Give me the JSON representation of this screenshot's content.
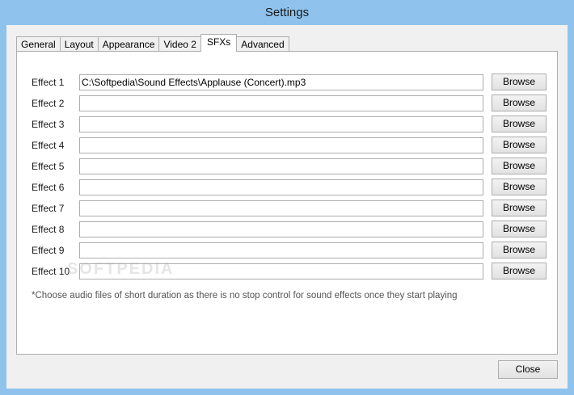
{
  "window": {
    "title": "Settings"
  },
  "tabs": [
    {
      "label": "General",
      "active": false
    },
    {
      "label": "Layout",
      "active": false
    },
    {
      "label": "Appearance",
      "active": false
    },
    {
      "label": "Video 2",
      "active": false
    },
    {
      "label": "SFXs",
      "active": true
    },
    {
      "label": "Advanced",
      "active": false
    }
  ],
  "effects": [
    {
      "label": "Effect 1",
      "value": "C:\\Softpedia\\Sound Effects\\Applause (Concert).mp3",
      "browse": "Browse"
    },
    {
      "label": "Effect 2",
      "value": "",
      "browse": "Browse"
    },
    {
      "label": "Effect 3",
      "value": "",
      "browse": "Browse"
    },
    {
      "label": "Effect 4",
      "value": "",
      "browse": "Browse"
    },
    {
      "label": "Effect 5",
      "value": "",
      "browse": "Browse"
    },
    {
      "label": "Effect 6",
      "value": "",
      "browse": "Browse"
    },
    {
      "label": "Effect 7",
      "value": "",
      "browse": "Browse"
    },
    {
      "label": "Effect 8",
      "value": "",
      "browse": "Browse"
    },
    {
      "label": "Effect 9",
      "value": "",
      "browse": "Browse"
    },
    {
      "label": "Effect 10",
      "value": "",
      "browse": "Browse"
    }
  ],
  "note": "*Choose audio files of short duration as there is no stop control for sound effects once they start playing",
  "watermark": "SOFTPEDIA",
  "footer": {
    "close_label": "Close"
  }
}
